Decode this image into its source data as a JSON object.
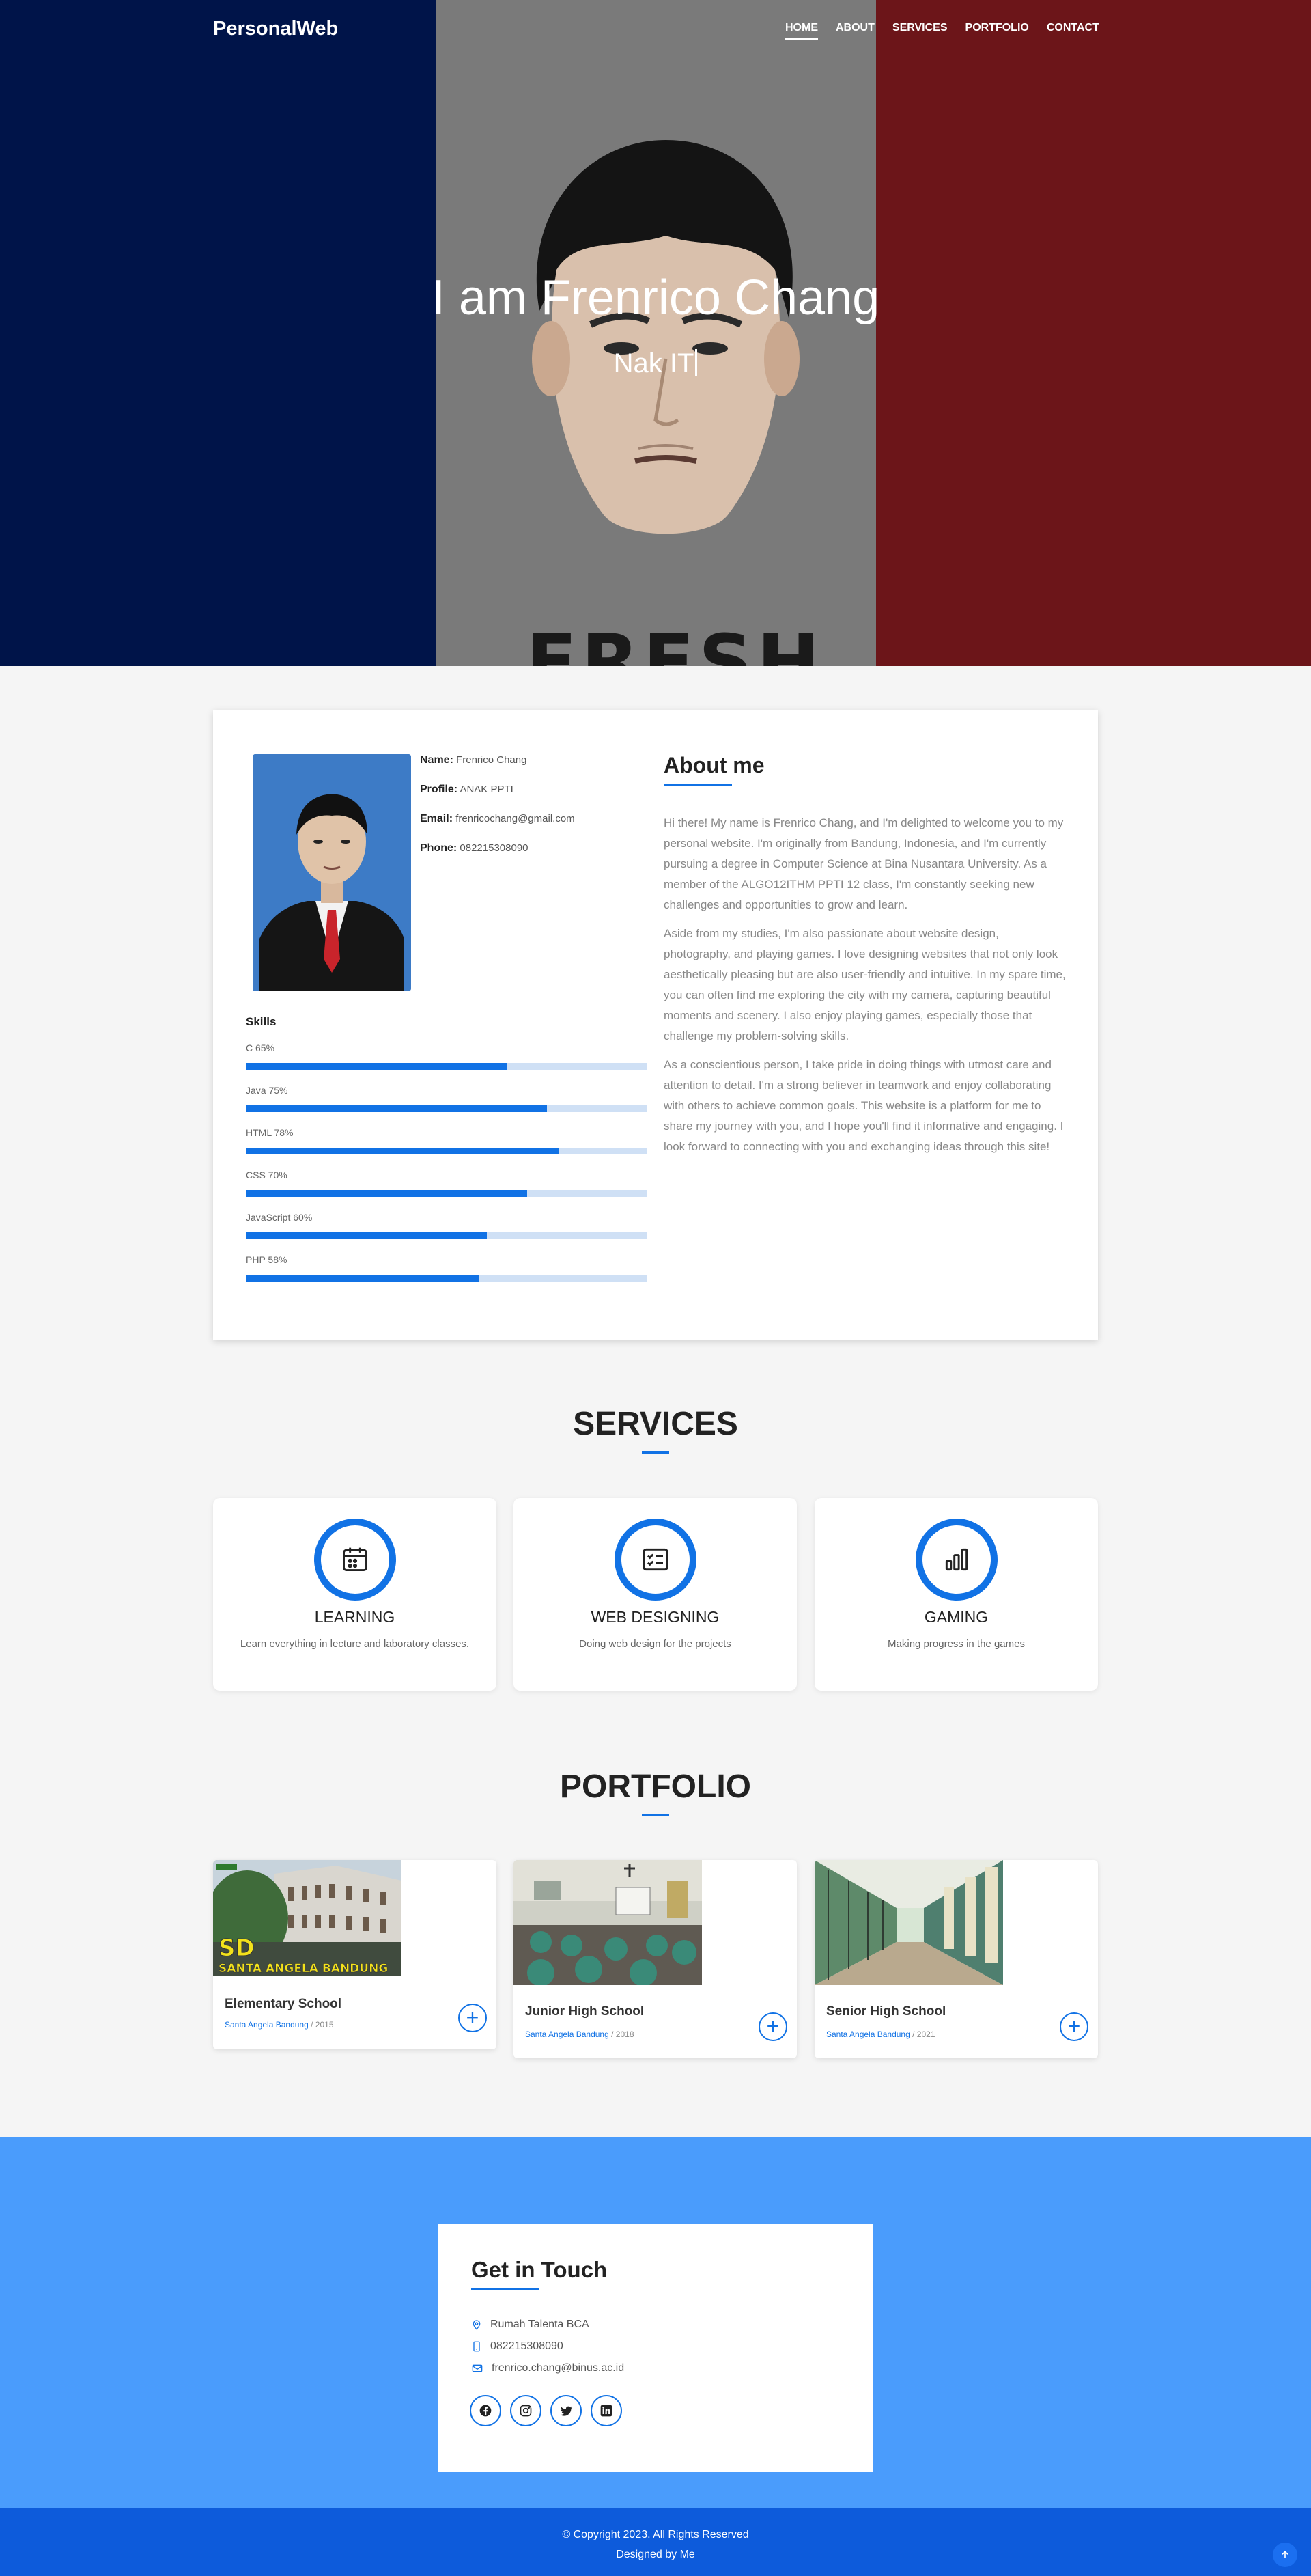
{
  "navbar": {
    "logo": "PersonalWeb",
    "links": [
      {
        "label": "HOME",
        "active": true
      },
      {
        "label": "ABOUT",
        "active": false
      },
      {
        "label": "SERVICES",
        "active": false
      },
      {
        "label": "PORTFOLIO",
        "active": false
      },
      {
        "label": "CONTACT",
        "active": false
      }
    ]
  },
  "hero": {
    "title": "I am Frenrico Chang",
    "subtitle": "Nak IT",
    "shirt_text": "FRESH",
    "colors": {
      "blue": "#001449",
      "grey": "#7a7a7a",
      "red": "#6c1519"
    }
  },
  "about": {
    "info": {
      "name_label": "Name:",
      "name": "Frenrico Chang",
      "profile_label": "Profile:",
      "profile": "ANAK PPTI",
      "email_label": "Email:",
      "email": "frenricochang@gmail.com",
      "phone_label": "Phone:",
      "phone": "082215308090"
    },
    "skills_title": "Skills",
    "skills": [
      {
        "label": "C 65%",
        "value": 65
      },
      {
        "label": "Java 75%",
        "value": 75
      },
      {
        "label": "HTML 78%",
        "value": 78
      },
      {
        "label": "CSS 70%",
        "value": 70
      },
      {
        "label": "JavaScript 60%",
        "value": 60
      },
      {
        "label": "PHP 58%",
        "value": 58
      }
    ],
    "title": "About me",
    "paragraphs": [
      "Hi there! My name is Frenrico Chang, and I'm delighted to welcome you to my personal website. I'm originally from Bandung, Indonesia, and I'm currently pursuing a degree in Computer Science at Bina Nusantara University. As a member of the ALGO12ITHM PPTI 12 class, I'm constantly seeking new challenges and opportunities to grow and learn.",
      "Aside from my studies, I'm also passionate about website design, photography, and playing games. I love designing websites that not only look aesthetically pleasing but are also user-friendly and intuitive. In my spare time, you can often find me exploring the city with my camera, capturing beautiful moments and scenery. I also enjoy playing games, especially those that challenge my problem-solving skills.",
      "As a conscientious person, I take pride in doing things with utmost care and attention to detail. I'm a strong believer in teamwork and enjoy collaborating with others to achieve common goals. This website is a platform for me to share my journey with you, and I hope you'll find it informative and engaging. I look forward to connecting with you and exchanging ideas through this site!"
    ],
    "accent": "#1172e5"
  },
  "services": {
    "title": "SERVICES",
    "items": [
      {
        "name": "LEARNING",
        "desc": "Learn everything in lecture and laboratory classes.",
        "icon": "calendar-icon"
      },
      {
        "name": "WEB DESIGNING",
        "desc": "Doing web design for the projects",
        "icon": "checklist-icon"
      },
      {
        "name": "GAMING",
        "desc": "Making progress in the games",
        "icon": "bar-chart-icon"
      }
    ]
  },
  "portfolio": {
    "title": "PORTFOLIO",
    "items": [
      {
        "title": "Elementary School",
        "location": "Santa Angela Bandung",
        "year": "/ 2015",
        "img_text_1": "SD",
        "img_text_2": "SANTA ANGELA BANDUNG"
      },
      {
        "title": "Junior High School",
        "location": "Santa Angela Bandung",
        "year": "/ 2018"
      },
      {
        "title": "Senior High School",
        "location": "Santa Angela Bandung",
        "year": "/ 2021"
      }
    ]
  },
  "contact": {
    "title": "Get in Touch",
    "address": "Rumah Talenta BCA",
    "phone": "082215308090",
    "email": "frenrico.chang@binus.ac.id",
    "socials": [
      "facebook-icon",
      "instagram-icon",
      "twitter-icon",
      "linkedin-icon"
    ],
    "bg": "#4a9cfc"
  },
  "footer": {
    "copyright": "© Copyright 2023. All Rights Reserved",
    "designed": "Designed by Me"
  }
}
